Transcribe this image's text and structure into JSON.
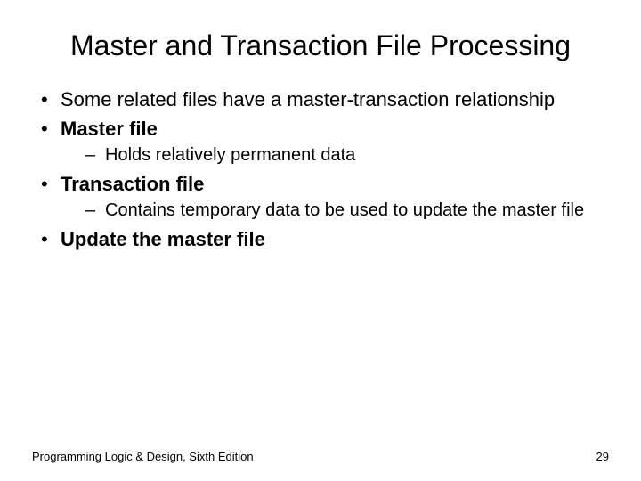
{
  "title": "Master and Transaction File Processing",
  "bullets": {
    "b1": "Some related files have a master-transaction relationship",
    "b2": "Master file",
    "b2_1": "Holds relatively permanent data",
    "b3": "Transaction file",
    "b3_1": "Contains temporary data to be used to update the master file",
    "b4": "Update the master file"
  },
  "footer": {
    "left": "Programming Logic & Design, Sixth Edition",
    "right": "29"
  }
}
